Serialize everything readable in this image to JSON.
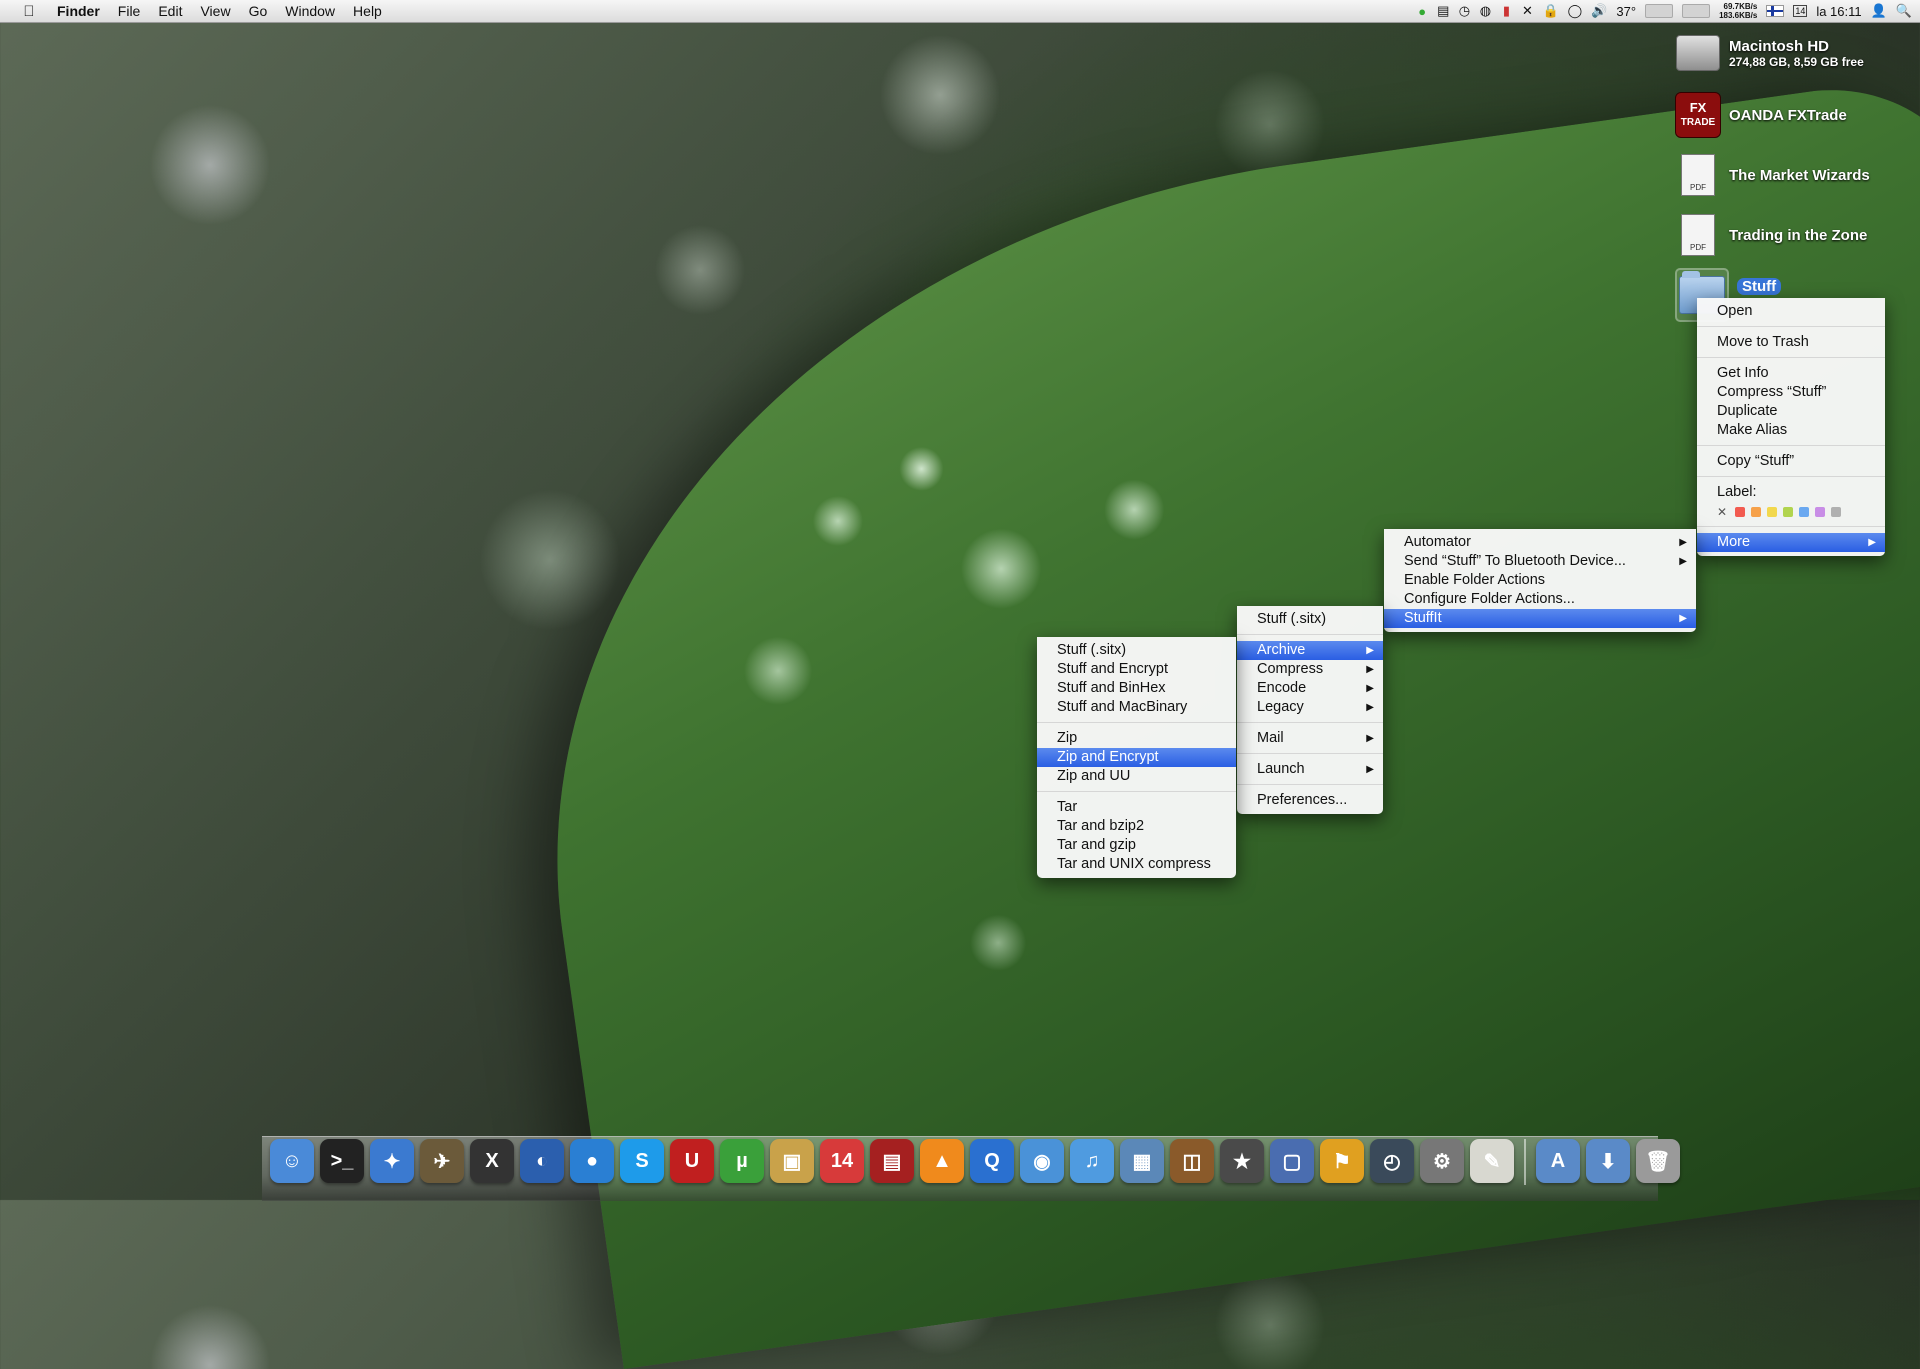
{
  "menubar": {
    "apple": "",
    "items": [
      "Finder",
      "File",
      "Edit",
      "View",
      "Go",
      "Window",
      "Help"
    ],
    "status": {
      "temp": "37°",
      "net_up": "69.7KB/s",
      "net_down": "183.6KB/s",
      "calendar_day": "14",
      "clock": "la 16:11",
      "search_icon": "🔍",
      "user_icon": "👤",
      "volume_icon": "🔊",
      "lock_icon": "🔒"
    }
  },
  "desktop": {
    "macintosh_hd": {
      "name": "Macintosh HD",
      "sub": "274,88 GB, 8,59 GB free"
    },
    "oanda": {
      "name": "OANDA FXTrade",
      "logo_line1": "FX",
      "logo_line2": "TRADE"
    },
    "market_wizards": {
      "name": "The Market Wizards",
      "badge": "PDF"
    },
    "trading_zone": {
      "name": "Trading in the Zone",
      "badge": "PDF"
    },
    "stuff": {
      "name": "Stuff"
    }
  },
  "context_menu": {
    "open": "Open",
    "move_to_trash": "Move to Trash",
    "get_info": "Get Info",
    "compress": "Compress “Stuff”",
    "duplicate": "Duplicate",
    "make_alias": "Make Alias",
    "copy": "Copy “Stuff”",
    "label_title": "Label:",
    "label_clear": "✕",
    "label_colors": [
      "#f25b50",
      "#f6a14a",
      "#f2d84d",
      "#b1d44e",
      "#6aa8f0",
      "#c88de6",
      "#b0b0b0"
    ],
    "more": "More"
  },
  "more_menu": {
    "automator": "Automator",
    "bluetooth": "Send “Stuff” To Bluetooth Device...",
    "enable_folder_actions": "Enable Folder Actions",
    "configure_folder_actions": "Configure Folder Actions...",
    "stuffit": "StuffIt"
  },
  "stuffit_menu": {
    "stuff_sitx": "Stuff (.sitx)",
    "archive": "Archive",
    "compress": "Compress",
    "encode": "Encode",
    "legacy": "Legacy",
    "mail": "Mail",
    "launch": "Launch",
    "preferences": "Preferences..."
  },
  "archive_menu": {
    "stuff_sitx": "Stuff (.sitx)",
    "stuff_encrypt": "Stuff and Encrypt",
    "stuff_binhex": "Stuff and BinHex",
    "stuff_macbinary": "Stuff and MacBinary",
    "zip": "Zip",
    "zip_encrypt": "Zip and Encrypt",
    "zip_uu": "Zip and UU",
    "tar": "Tar",
    "tar_bzip2": "Tar and bzip2",
    "tar_gzip": "Tar and gzip",
    "tar_unix": "Tar and UNIX compress"
  },
  "dock": {
    "apps": [
      {
        "icon": "finder-icon",
        "glyph": "☺",
        "color": "#4a8ad8"
      },
      {
        "icon": "terminal-icon",
        "glyph": ">_",
        "color": "#222222"
      },
      {
        "icon": "safari-icon",
        "glyph": "✦",
        "color": "#3b7ad0"
      },
      {
        "icon": "preview-icon",
        "glyph": "✈",
        "color": "#6b5a3a"
      },
      {
        "icon": "x11-icon",
        "glyph": "X",
        "color": "#333333"
      },
      {
        "icon": "google-earth-icon",
        "glyph": "◐",
        "color": "#2b5fae"
      },
      {
        "icon": "facetime-icon",
        "glyph": "●",
        "color": "#2a7fd3"
      },
      {
        "icon": "skype-icon",
        "glyph": "S",
        "color": "#1e9bea"
      },
      {
        "icon": "magnet-icon",
        "glyph": "U",
        "color": "#c01f1f"
      },
      {
        "icon": "utorrent-icon",
        "glyph": "µ",
        "color": "#3aa03a"
      },
      {
        "icon": "transmit-icon",
        "glyph": "▣",
        "color": "#c9a24a"
      },
      {
        "icon": "ical-icon",
        "glyph": "14",
        "color": "#d73a3a"
      },
      {
        "icon": "photo-booth-icon",
        "glyph": "▤",
        "color": "#a52020"
      },
      {
        "icon": "vlc-icon",
        "glyph": "▲",
        "color": "#f08a1c"
      },
      {
        "icon": "quicktime-icon",
        "glyph": "Q",
        "color": "#2a70d0"
      },
      {
        "icon": "preview-eye-icon",
        "glyph": "◉",
        "color": "#4a92d8"
      },
      {
        "icon": "itunes-icon",
        "glyph": "♫",
        "color": "#4f9be0"
      },
      {
        "icon": "iphoto-icon",
        "glyph": "▦",
        "color": "#5b88b8"
      },
      {
        "icon": "image-capture-icon",
        "glyph": "◫",
        "color": "#8a5a2a"
      },
      {
        "icon": "imovie-icon",
        "glyph": "★",
        "color": "#4a4a4a"
      },
      {
        "icon": "vmware-icon",
        "glyph": "▢",
        "color": "#4a6db0"
      },
      {
        "icon": "hair-dryer-icon",
        "glyph": "⚑",
        "color": "#e0a020"
      },
      {
        "icon": "time-machine-icon",
        "glyph": "◴",
        "color": "#3a4a5a"
      },
      {
        "icon": "system-preferences-icon",
        "glyph": "⚙",
        "color": "#777777"
      },
      {
        "icon": "textedit-icon",
        "glyph": "✎",
        "color": "#d8d8d0"
      }
    ],
    "stacks": [
      {
        "icon": "applications-folder-icon",
        "glyph": "A",
        "color": "#5a8ac8"
      },
      {
        "icon": "downloads-folder-icon",
        "glyph": "⬇",
        "color": "#5a8ac8"
      },
      {
        "icon": "trash-icon",
        "glyph": "🗑",
        "color": "#9a9a9a"
      }
    ]
  }
}
